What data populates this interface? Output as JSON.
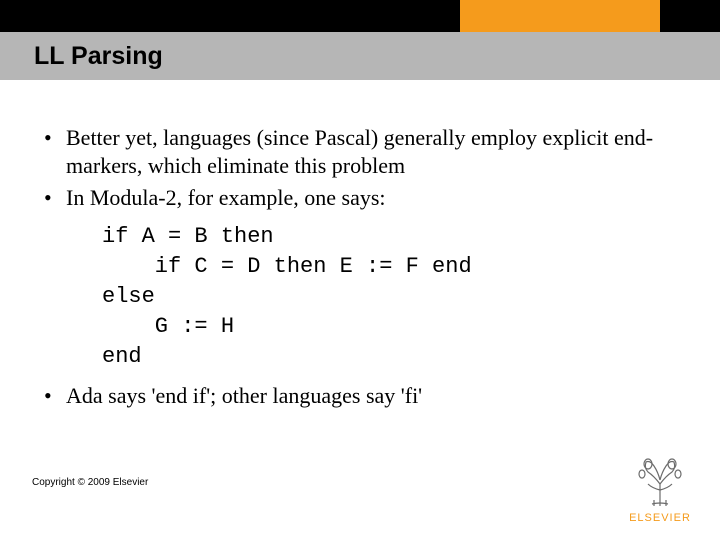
{
  "title": "LL Parsing",
  "bullets": [
    "Better yet, languages (since Pascal) generally employ explicit end-markers, which eliminate this problem",
    "In Modula-2, for example, one says:"
  ],
  "code": "if A = B then\n    if C = D then E := F end\nelse\n    G := H\nend",
  "bullet_after": "Ada says 'end if'; other languages say 'fi'",
  "copyright": "Copyright © 2009 Elsevier",
  "logo_brand": "ELSEVIER"
}
